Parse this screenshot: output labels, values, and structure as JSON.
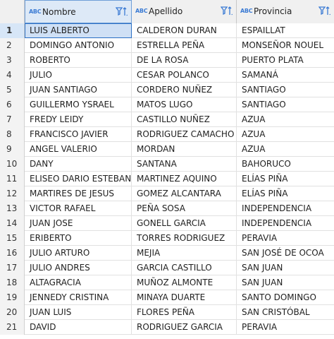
{
  "columns": [
    {
      "type_icon": "ABC",
      "label": "Nombre"
    },
    {
      "type_icon": "ABC",
      "label": "Apellido"
    },
    {
      "type_icon": "ABC",
      "label": "Provincia"
    }
  ],
  "rows": [
    {
      "num": "1",
      "nombre": "LUIS ALBERTO",
      "apellido": "CALDERON DURAN",
      "provincia": "ESPAILLAT"
    },
    {
      "num": "2",
      "nombre": "DOMINGO ANTONIO",
      "apellido": "ESTRELLA PEÑA",
      "provincia": "MONSEÑOR NOUEL"
    },
    {
      "num": "3",
      "nombre": "ROBERTO",
      "apellido": "DE LA ROSA",
      "provincia": "PUERTO PLATA"
    },
    {
      "num": "4",
      "nombre": "JULIO",
      "apellido": "CESAR POLANCO",
      "provincia": "SAMANÁ"
    },
    {
      "num": "5",
      "nombre": "JUAN SANTIAGO",
      "apellido": "CORDERO NUÑEZ",
      "provincia": "SANTIAGO"
    },
    {
      "num": "6",
      "nombre": "GUILLERMO YSRAEL",
      "apellido": "MATOS LUGO",
      "provincia": "SANTIAGO"
    },
    {
      "num": "7",
      "nombre": "FREDY LEIDY",
      "apellido": "CASTILLO NUÑEZ",
      "provincia": "AZUA"
    },
    {
      "num": "8",
      "nombre": "FRANCISCO JAVIER",
      "apellido": "RODRIGUEZ CAMACHO",
      "provincia": "AZUA"
    },
    {
      "num": "9",
      "nombre": "ANGEL VALERIO",
      "apellido": "MORDAN",
      "provincia": "AZUA"
    },
    {
      "num": "10",
      "nombre": "DANY",
      "apellido": "SANTANA",
      "provincia": "BAHORUCO"
    },
    {
      "num": "11",
      "nombre": "ELISEO DARIO ESTEBAN",
      "apellido": "MARTINEZ AQUINO",
      "provincia": "ELÍAS PIÑA"
    },
    {
      "num": "12",
      "nombre": "MARTIRES DE JESUS",
      "apellido": "GOMEZ ALCANTARA",
      "provincia": "ELÍAS PIÑA"
    },
    {
      "num": "13",
      "nombre": "VICTOR RAFAEL",
      "apellido": "PEÑA SOSA",
      "provincia": "INDEPENDENCIA"
    },
    {
      "num": "14",
      "nombre": "JUAN JOSE",
      "apellido": "GONELL GARCIA",
      "provincia": "INDEPENDENCIA"
    },
    {
      "num": "15",
      "nombre": "ERIBERTO",
      "apellido": "TORRES RODRIGUEZ",
      "provincia": "PERAVIA"
    },
    {
      "num": "16",
      "nombre": "JULIO ARTURO",
      "apellido": "MEJIA",
      "provincia": "SAN JOSÉ DE OCOA"
    },
    {
      "num": "17",
      "nombre": "JULIO ANDRES",
      "apellido": "GARCIA CASTILLO",
      "provincia": "SAN JUAN"
    },
    {
      "num": "18",
      "nombre": "ALTAGRACIA",
      "apellido": "MUÑOZ ALMONTE",
      "provincia": "SAN JUAN"
    },
    {
      "num": "19",
      "nombre": "JENNEDY CRISTINA",
      "apellido": "MINAYA DUARTE",
      "provincia": "SANTO DOMINGO"
    },
    {
      "num": "20",
      "nombre": "JUAN LUIS",
      "apellido": "FLORES PEÑA",
      "provincia": "SAN CRISTÓBAL"
    },
    {
      "num": "21",
      "nombre": "DAVID",
      "apellido": "RODRIGUEZ GARCIA",
      "provincia": "PERAVIA"
    }
  ],
  "colors": {
    "accent": "#2b6fc4",
    "icon": "#3b7bd4"
  }
}
